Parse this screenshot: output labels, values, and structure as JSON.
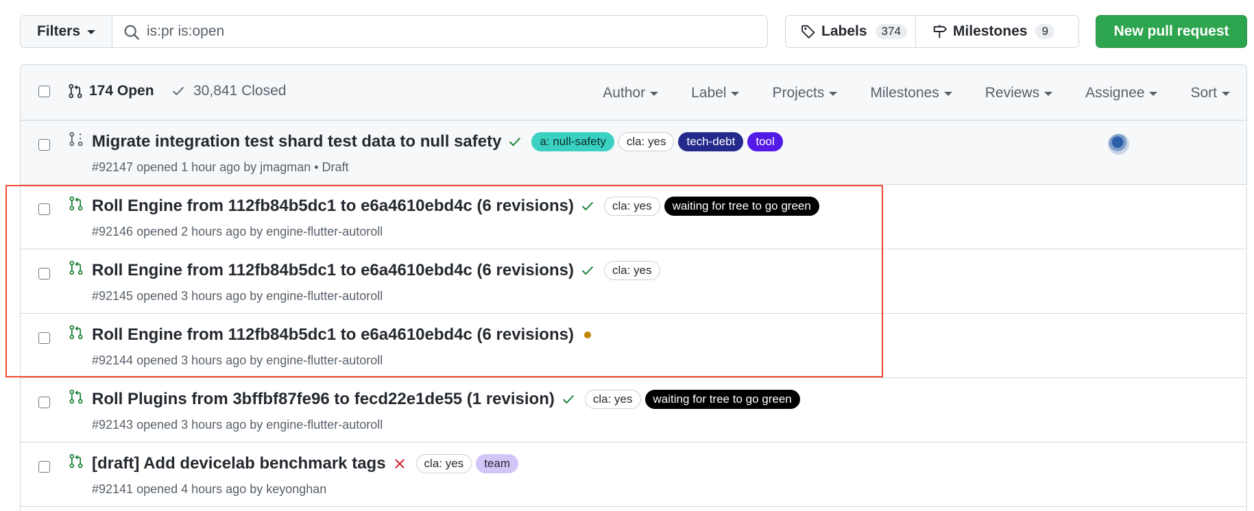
{
  "toolbar": {
    "filters_label": "Filters",
    "search_value": "is:pr is:open",
    "labels_label": "Labels",
    "labels_count": "374",
    "milestones_label": "Milestones",
    "milestones_count": "9",
    "new_pr_label": "New pull request"
  },
  "header": {
    "open_label": "174 Open",
    "closed_label": "30,841 Closed",
    "menus": [
      "Author",
      "Label",
      "Projects",
      "Milestones",
      "Reviews",
      "Assignee",
      "Sort"
    ]
  },
  "colors": {
    "accent_green": "#2da44e",
    "check_green": "#1a7f37",
    "pending_yellow": "#bf8700",
    "fail_red": "#cf222e",
    "highlight_border": "#f0482a"
  },
  "pull_requests": [
    {
      "title": "Migrate integration test shard test data to null safety",
      "status": "success",
      "draft": true,
      "labels": [
        {
          "name": "a: null-safety",
          "bg": "#3ad1c3",
          "fg": "#0b2e2b",
          "border": "#3ad1c3"
        },
        {
          "name": "cla: yes",
          "bg": "#ffffff",
          "fg": "#24292f",
          "border": "#c9ced4"
        },
        {
          "name": "tech-debt",
          "bg": "#242a8b",
          "fg": "#ffffff",
          "border": "#242a8b"
        },
        {
          "name": "tool",
          "bg": "#5319e7",
          "fg": "#ffffff",
          "border": "#5319e7"
        }
      ],
      "meta": "#92147 opened 1 hour ago by jmagman • Draft",
      "has_avatar": true
    },
    {
      "title": "Roll Engine from 112fb84b5dc1 to e6a4610ebd4c (6 revisions)",
      "status": "success",
      "draft": false,
      "labels": [
        {
          "name": "cla: yes",
          "bg": "#ffffff",
          "fg": "#24292f",
          "border": "#c9ced4"
        },
        {
          "name": "waiting for tree to go green",
          "bg": "#000000",
          "fg": "#ffffff",
          "border": "#000000"
        }
      ],
      "meta": "#92146 opened 2 hours ago by engine-flutter-autoroll",
      "has_avatar": false
    },
    {
      "title": "Roll Engine from 112fb84b5dc1 to e6a4610ebd4c (6 revisions)",
      "status": "success",
      "draft": false,
      "labels": [
        {
          "name": "cla: yes",
          "bg": "#ffffff",
          "fg": "#24292f",
          "border": "#c9ced4"
        }
      ],
      "meta": "#92145 opened 3 hours ago by engine-flutter-autoroll",
      "has_avatar": false
    },
    {
      "title": "Roll Engine from 112fb84b5dc1 to e6a4610ebd4c (6 revisions)",
      "status": "pending",
      "draft": false,
      "labels": [],
      "meta": "#92144 opened 3 hours ago by engine-flutter-autoroll",
      "has_avatar": false
    },
    {
      "title": "Roll Plugins from 3bffbf87fe96 to fecd22e1de55 (1 revision)",
      "status": "success",
      "draft": false,
      "labels": [
        {
          "name": "cla: yes",
          "bg": "#ffffff",
          "fg": "#24292f",
          "border": "#c9ced4"
        },
        {
          "name": "waiting for tree to go green",
          "bg": "#000000",
          "fg": "#ffffff",
          "border": "#000000"
        }
      ],
      "meta": "#92143 opened 3 hours ago by engine-flutter-autoroll",
      "has_avatar": false
    },
    {
      "title": "[draft] Add devicelab benchmark tags",
      "status": "failure",
      "draft": false,
      "labels": [
        {
          "name": "cla: yes",
          "bg": "#ffffff",
          "fg": "#24292f",
          "border": "#c9ced4"
        },
        {
          "name": "team",
          "bg": "#d4c5f9",
          "fg": "#24292f",
          "border": "#d4c5f9"
        }
      ],
      "meta": "#92141 opened 4 hours ago by keyonghan",
      "has_avatar": false
    }
  ]
}
